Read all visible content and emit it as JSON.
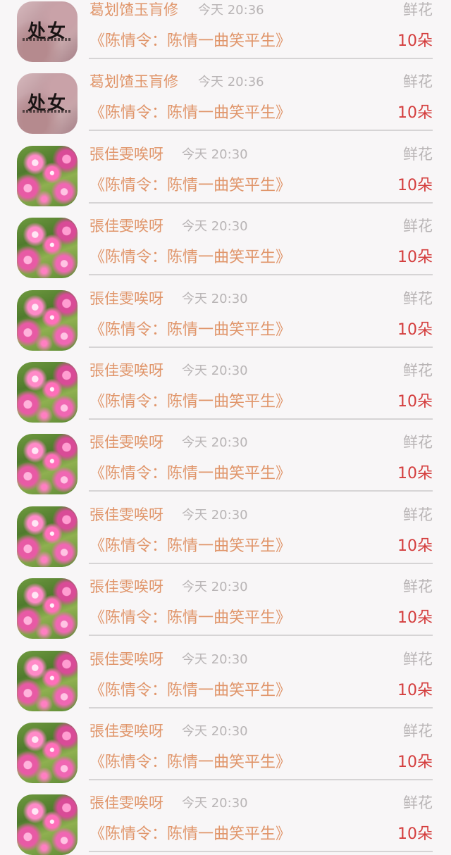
{
  "items": [
    {
      "avatar": "girl-art",
      "avatar_text": "处女",
      "name": "葛划馇玉肓修",
      "time": "今天 20:36",
      "gift": "鲜花",
      "song": "《陈情令：陈情一曲笑平生》",
      "count": "10朵"
    },
    {
      "avatar": "girl-art",
      "avatar_text": "处女",
      "name": "葛划馇玉肓修",
      "time": "今天 20:36",
      "gift": "鲜花",
      "song": "《陈情令：陈情一曲笑平生》",
      "count": "10朵"
    },
    {
      "avatar": "flower-photo",
      "name": "張佳雯唉呀",
      "time": "今天 20:30",
      "gift": "鲜花",
      "song": "《陈情令：陈情一曲笑平生》",
      "count": "10朵"
    },
    {
      "avatar": "flower-photo",
      "name": "張佳雯唉呀",
      "time": "今天 20:30",
      "gift": "鲜花",
      "song": "《陈情令：陈情一曲笑平生》",
      "count": "10朵"
    },
    {
      "avatar": "flower-photo",
      "name": "張佳雯唉呀",
      "time": "今天 20:30",
      "gift": "鲜花",
      "song": "《陈情令：陈情一曲笑平生》",
      "count": "10朵"
    },
    {
      "avatar": "flower-photo",
      "name": "張佳雯唉呀",
      "time": "今天 20:30",
      "gift": "鲜花",
      "song": "《陈情令：陈情一曲笑平生》",
      "count": "10朵"
    },
    {
      "avatar": "flower-photo",
      "name": "張佳雯唉呀",
      "time": "今天 20:30",
      "gift": "鲜花",
      "song": "《陈情令：陈情一曲笑平生》",
      "count": "10朵"
    },
    {
      "avatar": "flower-photo",
      "name": "張佳雯唉呀",
      "time": "今天 20:30",
      "gift": "鲜花",
      "song": "《陈情令：陈情一曲笑平生》",
      "count": "10朵"
    },
    {
      "avatar": "flower-photo",
      "name": "張佳雯唉呀",
      "time": "今天 20:30",
      "gift": "鲜花",
      "song": "《陈情令：陈情一曲笑平生》",
      "count": "10朵"
    },
    {
      "avatar": "flower-photo",
      "name": "張佳雯唉呀",
      "time": "今天 20:30",
      "gift": "鲜花",
      "song": "《陈情令：陈情一曲笑平生》",
      "count": "10朵"
    },
    {
      "avatar": "flower-photo",
      "name": "張佳雯唉呀",
      "time": "今天 20:30",
      "gift": "鲜花",
      "song": "《陈情令：陈情一曲笑平生》",
      "count": "10朵"
    },
    {
      "avatar": "flower-photo",
      "name": "張佳雯唉呀",
      "time": "今天 20:30",
      "gift": "鲜花",
      "song": "《陈情令：陈情一曲笑平生》",
      "count": "10朵"
    }
  ],
  "colors": {
    "name": "#e0956a",
    "time": "#b8b4b5",
    "gift": "#b8b4b5",
    "song": "#e0956a",
    "count": "#d43d3d",
    "background": "#f8f6f7",
    "divider": "#d6d4d5"
  }
}
